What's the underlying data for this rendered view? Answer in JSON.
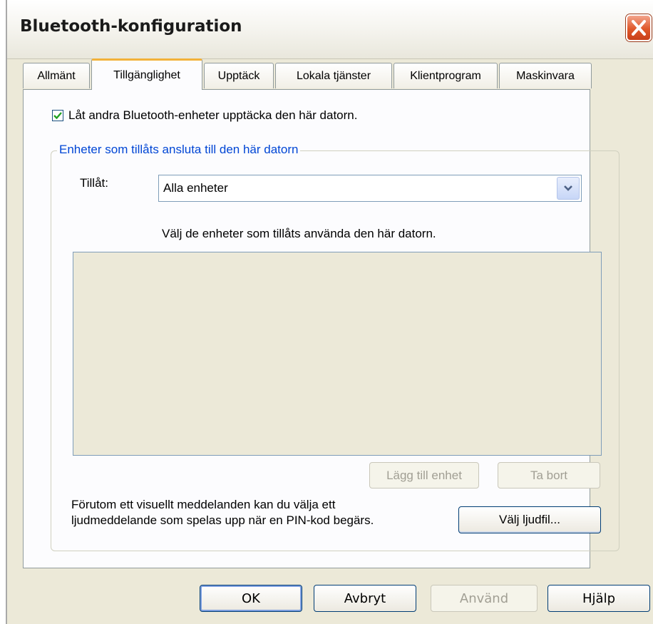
{
  "window": {
    "title": "Bluetooth-konfiguration"
  },
  "tabs": [
    {
      "label": "Allmänt"
    },
    {
      "label": "Tillgänglighet"
    },
    {
      "label": "Upptäck"
    },
    {
      "label": "Lokala tjänster"
    },
    {
      "label": "Klientprogram"
    },
    {
      "label": "Maskinvara"
    }
  ],
  "active_tab": "Tillgänglighet",
  "discover": {
    "checked": true,
    "label": "Låt andra Bluetooth-enheter upptäcka den här datorn."
  },
  "group": {
    "legend": "Enheter som tillåts ansluta till den här datorn",
    "allow_label": "Tillåt:",
    "allow_value": "Alla enheter",
    "hint": "Välj de enheter som tillåts använda den här datorn.",
    "add_device": "Lägg till enhet",
    "remove": "Ta bort",
    "info_line1": "Förutom ett visuellt meddelanden kan du välja ett",
    "info_line2": "ljudmeddelande som spelas upp när en PIN-kod begärs.",
    "choose_sound": "Välj ljudfil..."
  },
  "footer": {
    "ok": "OK",
    "cancel": "Avbryt",
    "apply": "Använd",
    "help": "Hjälp"
  },
  "icons": {
    "close": "close-icon",
    "check": "checkmark-icon",
    "dropdown": "chevron-down-icon"
  }
}
